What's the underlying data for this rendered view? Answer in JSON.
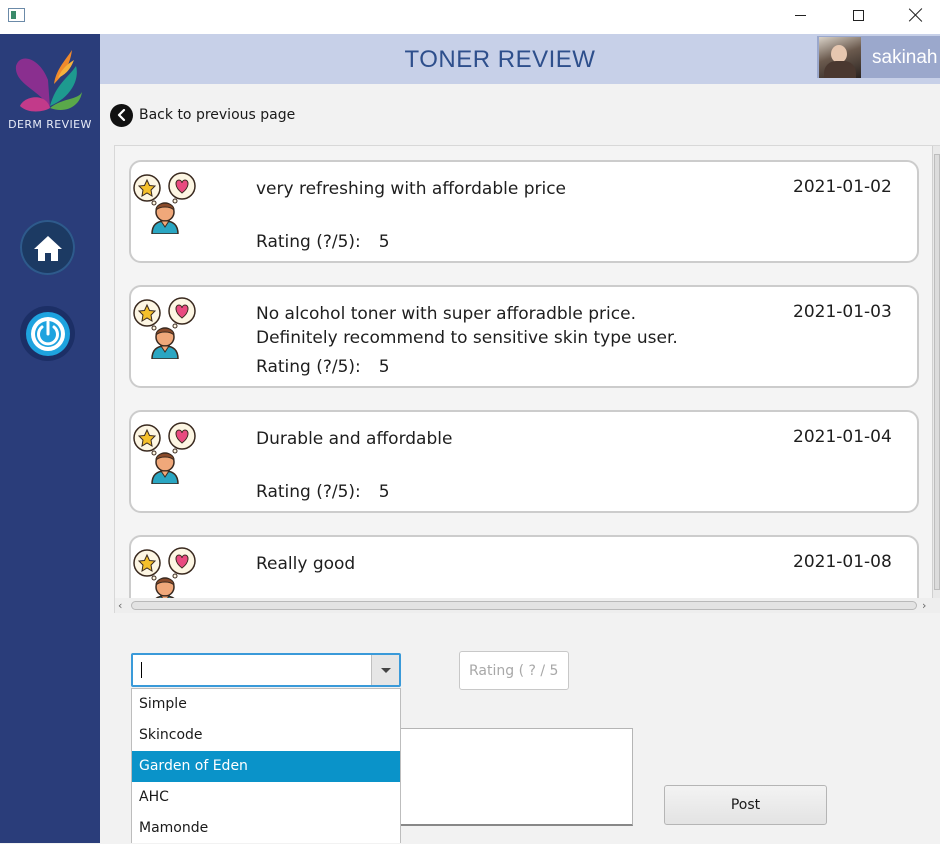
{
  "sidebar": {
    "brand": "DERM REVIEW",
    "home_icon": "home-icon",
    "power_icon": "power-icon"
  },
  "header": {
    "title": "TONER REVIEW",
    "username": "sakinah"
  },
  "back": {
    "label": "Back to previous page"
  },
  "reviews": [
    {
      "comment": "very refreshing with affordable price",
      "date": "2021-01-02",
      "rating_label": "Rating (?/5):",
      "rating": "5"
    },
    {
      "comment": "No alcohol toner with super afforadble price.\nDefinitely recommend to sensitive skin type user.",
      "date": "2021-01-03",
      "rating_label": "Rating (?/5):",
      "rating": "5"
    },
    {
      "comment": "Durable and affordable",
      "date": "2021-01-04",
      "rating_label": "Rating (?/5):",
      "rating": "5"
    },
    {
      "comment": "Really good",
      "date": "2021-01-08",
      "rating_label": "",
      "rating": ""
    }
  ],
  "form": {
    "product_value": "",
    "rating_placeholder": "Rating ( ? / 5)",
    "post_label": "Post",
    "options": [
      "Simple",
      "Skincode",
      "Garden of Eden",
      "AHC",
      "Mamonde"
    ],
    "selected_option": "Garden of Eden"
  },
  "colors": {
    "sidebar": "#2a3d7a",
    "header": "#c7d0e8",
    "accent": "#0a93c9"
  }
}
